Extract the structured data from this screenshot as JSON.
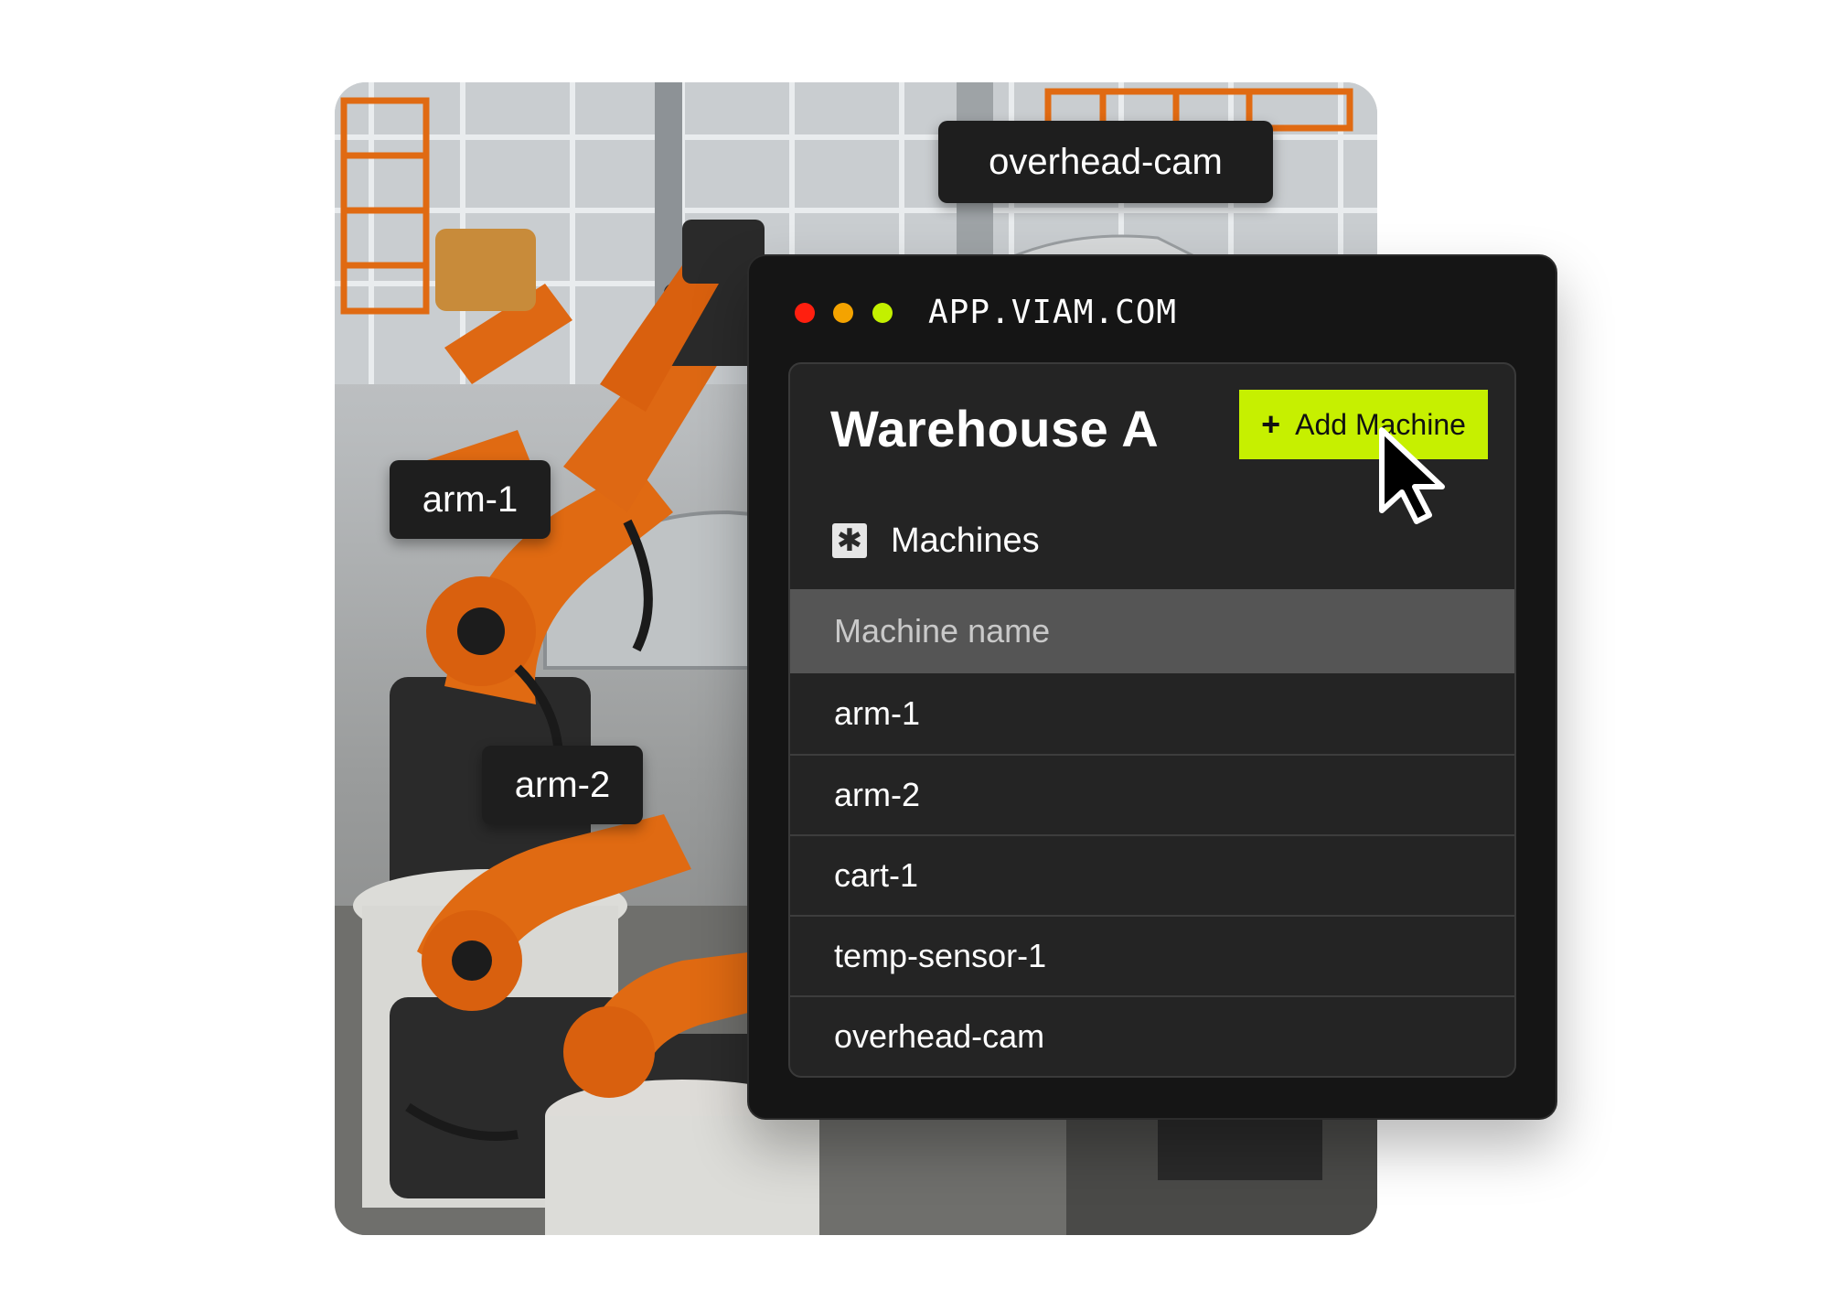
{
  "background_photo": {
    "tags": {
      "overhead_cam": "overhead-cam",
      "arm_1": "arm-1",
      "arm_2": "arm-2"
    }
  },
  "window": {
    "url": "APP.VIAM.COM",
    "traffic_lights": [
      "#ff1f0f",
      "#f4a300",
      "#c3f000"
    ]
  },
  "panel": {
    "title": "Warehouse A",
    "add_button": {
      "icon": "+",
      "label": "Add Machine",
      "color": "#c6f000"
    },
    "section": {
      "icon": "asterisk-icon",
      "label": "Machines"
    },
    "table": {
      "header": "Machine name",
      "rows": [
        "arm-1",
        "arm-2",
        "cart-1",
        "temp-sensor-1",
        "overhead-cam"
      ]
    }
  }
}
